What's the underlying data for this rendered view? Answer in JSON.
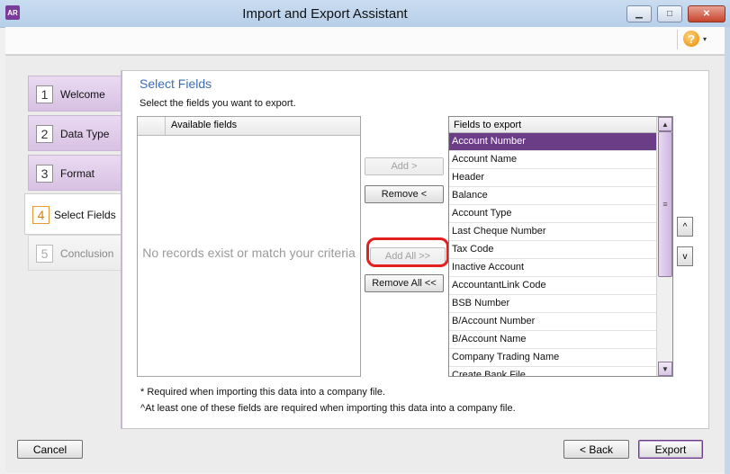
{
  "window": {
    "app_icon_text": "AR",
    "title": "Import and Export Assistant",
    "controls": {
      "minimize": "▁",
      "maximize": "□",
      "close": "✕"
    }
  },
  "toolbar": {
    "help_icon": "?",
    "help_caret": "▾"
  },
  "steps": [
    {
      "num": "1",
      "label": "Welcome"
    },
    {
      "num": "2",
      "label": "Data Type"
    },
    {
      "num": "3",
      "label": "Format"
    },
    {
      "num": "4",
      "label": "Select Fields"
    },
    {
      "num": "5",
      "label": "Conclusion"
    }
  ],
  "panel": {
    "title": "Select Fields",
    "subtitle": "Select the fields you want to export.",
    "available": {
      "header": "Available fields",
      "empty_message": "No records exist or match your criteria"
    },
    "buttons": {
      "add": "Add >",
      "remove": "Remove <",
      "add_all": "Add All >>",
      "remove_all": "Remove All <<",
      "move_up": "^",
      "move_down": "v"
    },
    "export": {
      "header": "Fields to export",
      "selected_index": 0,
      "rows": [
        "Account Number",
        "Account Name",
        "Header",
        "Balance",
        "Account Type",
        "Last Cheque Number",
        "Tax Code",
        "Inactive Account",
        "AccountantLink Code",
        "BSB Number",
        "B/Account Number",
        "B/Account Name",
        "Company Trading Name",
        "Create Bank File"
      ]
    },
    "scroll": {
      "up": "▲",
      "down": "▼",
      "grip": "≡"
    },
    "notes": [
      "* Required when importing this data into a company file.",
      "^At least one of these fields are required when importing this data into a company file."
    ]
  },
  "footer": {
    "cancel": "Cancel",
    "back": "< Back",
    "export": "Export"
  }
}
